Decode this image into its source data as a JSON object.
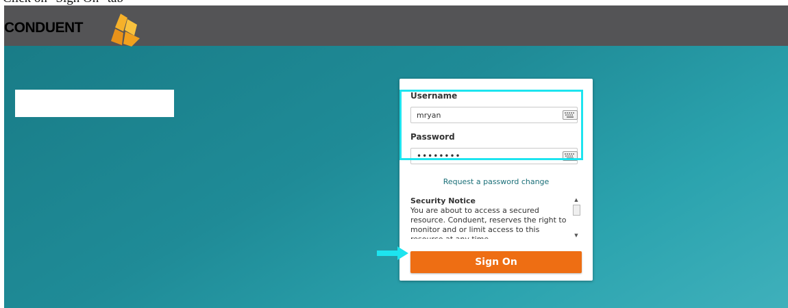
{
  "caption": "Click on \"Sign On\" tab",
  "brand": {
    "name": "CONDUENT",
    "accent": "#f2a01d",
    "header_bg": "#545456"
  },
  "login": {
    "username_label": "Username",
    "username_value": "mryan",
    "username_icon": "keyboard-icon",
    "password_label": "Password",
    "password_value": "••••••••",
    "password_icon": "keyboard-icon",
    "password_change_link": "Request a password change",
    "security_notice_title": "Security Notice",
    "security_notice_text": "You are about to access a secured resource. Conduent, reserves the right to monitor and or limit access to this resource at any time.",
    "sign_on_label": "Sign On",
    "sign_on_color": "#ee6e13"
  },
  "annotations": {
    "highlight_color": "#1de4ef",
    "arrow_color": "#1de4ef"
  }
}
